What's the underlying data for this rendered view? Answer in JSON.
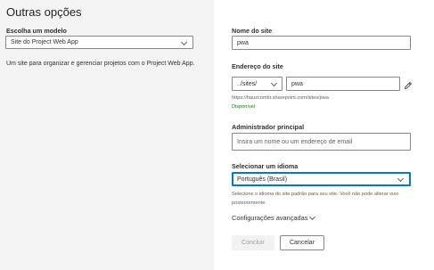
{
  "left": {
    "title": "Outras opções",
    "template_label": "Escolha um modelo",
    "template_value": "Site do Project Web App",
    "template_desc": "Um site para organizar e gerenciar projetos com o Project Web App."
  },
  "form": {
    "site_name_label": "Nome do site",
    "site_name_value": "pwa",
    "address_label": "Endereço do site",
    "path_value": "../sites/",
    "address_value": "pwa",
    "url_text": "https://hauzcombr.sharepoint.com/sites/pwa",
    "availability": "Disponível",
    "admin_label": "Administrador principal",
    "admin_placeholder": "Insira um nome ou um endereço de email",
    "language_label": "Selecionar um idioma",
    "language_value": "Português (Brasil)",
    "language_hint": "Selecione o idioma do site padrão para seu site. Você não pode alterar isso posteriormente.",
    "advanced_label": "Configurações avançadas",
    "finish_label": "Concluir",
    "cancel_label": "Cancelar"
  },
  "icons": {
    "edit": "pencil-icon",
    "dropdown": "chevron-down-icon"
  }
}
